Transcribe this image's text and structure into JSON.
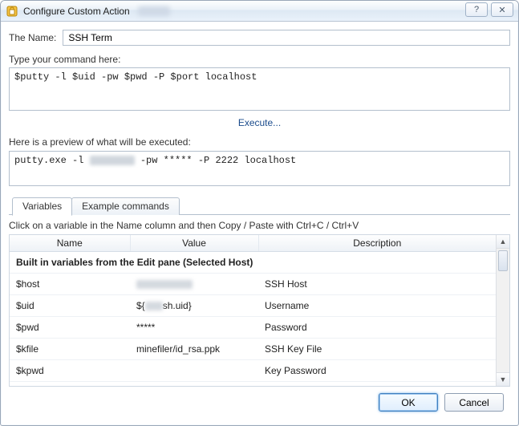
{
  "window": {
    "title": "Configure Custom Action",
    "help_glyph": "?",
    "close_glyph": "✕"
  },
  "name": {
    "label": "The Name:",
    "value": "SSH Term"
  },
  "command": {
    "label": "Type your command here:",
    "value": "$putty -l $uid -pw $pwd -P $port localhost"
  },
  "execute": "Execute...",
  "preview": {
    "label": "Here is a preview of what will be executed:",
    "prefix": "putty.exe -l ",
    "middle": " -pw ***** -P 2222 localhost"
  },
  "tabs": {
    "variables": "Variables",
    "examples": "Example commands"
  },
  "instruction": "Click on a variable in the Name column and then Copy / Paste with Ctrl+C / Ctrl+V",
  "columns": {
    "name": "Name",
    "value": "Value",
    "description": "Description"
  },
  "section_heading": "Built in variables from the Edit pane (Selected Host)",
  "rows": [
    {
      "name": "$host",
      "value_masked": true,
      "value": "",
      "desc": "SSH Host"
    },
    {
      "name": "$uid",
      "value_masked": "partial",
      "value_prefix": "${",
      "value_suffix": "sh.uid}",
      "desc": "Username"
    },
    {
      "name": "$pwd",
      "value": "*****",
      "desc": "Password"
    },
    {
      "name": "$kfile",
      "value": "minefiler/id_rsa.ppk",
      "desc": "SSH Key File"
    },
    {
      "name": "$kpwd",
      "value": "",
      "desc": "Key Password"
    }
  ],
  "buttons": {
    "ok": "OK",
    "cancel": "Cancel"
  },
  "scroll": {
    "up": "▲",
    "down": "▼"
  }
}
